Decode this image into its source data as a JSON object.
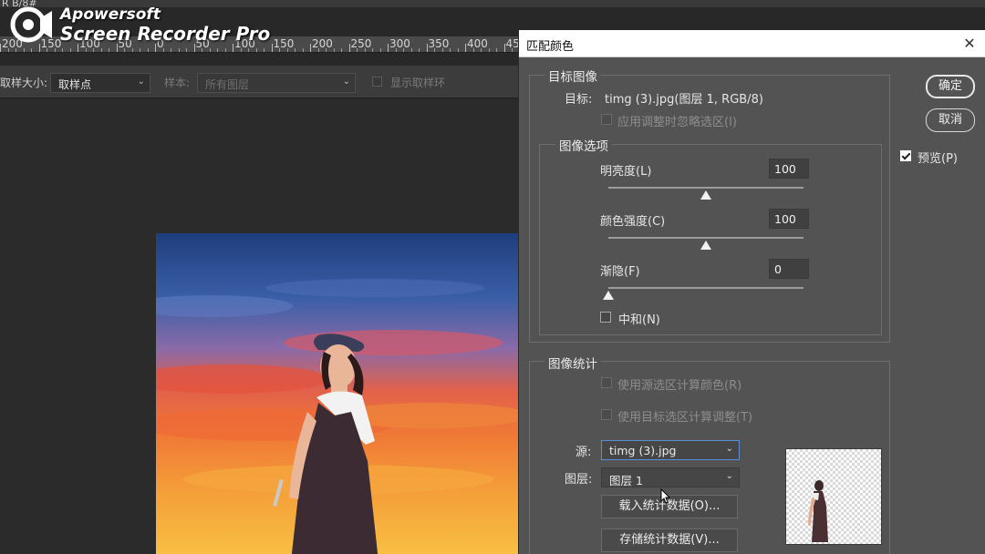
{
  "window_tab": "R B/8#",
  "watermark": {
    "brand": "Apowersoft",
    "product": "Screen Recorder Pro"
  },
  "ruler": {
    "ticks": [
      "200",
      "150",
      "100",
      "50",
      "0",
      "50",
      "100",
      "150",
      "200",
      "250",
      "300",
      "350",
      "400",
      "45"
    ]
  },
  "options_bar": {
    "sample_size_label": "取样大小:",
    "sample_size_value": "取样点",
    "sample_label": "样本:",
    "sample_value": "所有图层",
    "show_ring_label": "显示取样环"
  },
  "dialog": {
    "title": "匹配颜色",
    "target_group_label": "目标图像",
    "target_label": "目标:",
    "target_value": "timg (3).jpg(图层 1, RGB/8)",
    "ignore_selection_label": "应用调整时忽略选区(I)",
    "image_options_label": "图像选项",
    "luminance_label": "明亮度(L)",
    "luminance_value": "100",
    "luminance_level": 0.5,
    "color_intensity_label": "颜色强度(C)",
    "color_intensity_value": "100",
    "color_intensity_level": 0.5,
    "fade_label": "渐隐(F)",
    "fade_value": "0",
    "fade_level": 0,
    "neutralize_label": "中和(N)",
    "ok_label": "确定",
    "cancel_label": "取消",
    "preview_label": "预览(P)",
    "preview_checked": true,
    "stats_group_label": "图像统计",
    "use_source_selection_label": "使用源选区计算颜色(R)",
    "use_target_selection_label": "使用目标选区计算调整(T)",
    "source_label": "源:",
    "source_value": "timg (3).jpg",
    "layer_label": "图层:",
    "layer_value": "图层 1",
    "load_stats_label": "载入统计数据(O)...",
    "save_stats_label": "存储统计数据(V)..."
  },
  "colors": {
    "dialog_bg": "#535353",
    "focus_blue": "#5a8fd8"
  }
}
